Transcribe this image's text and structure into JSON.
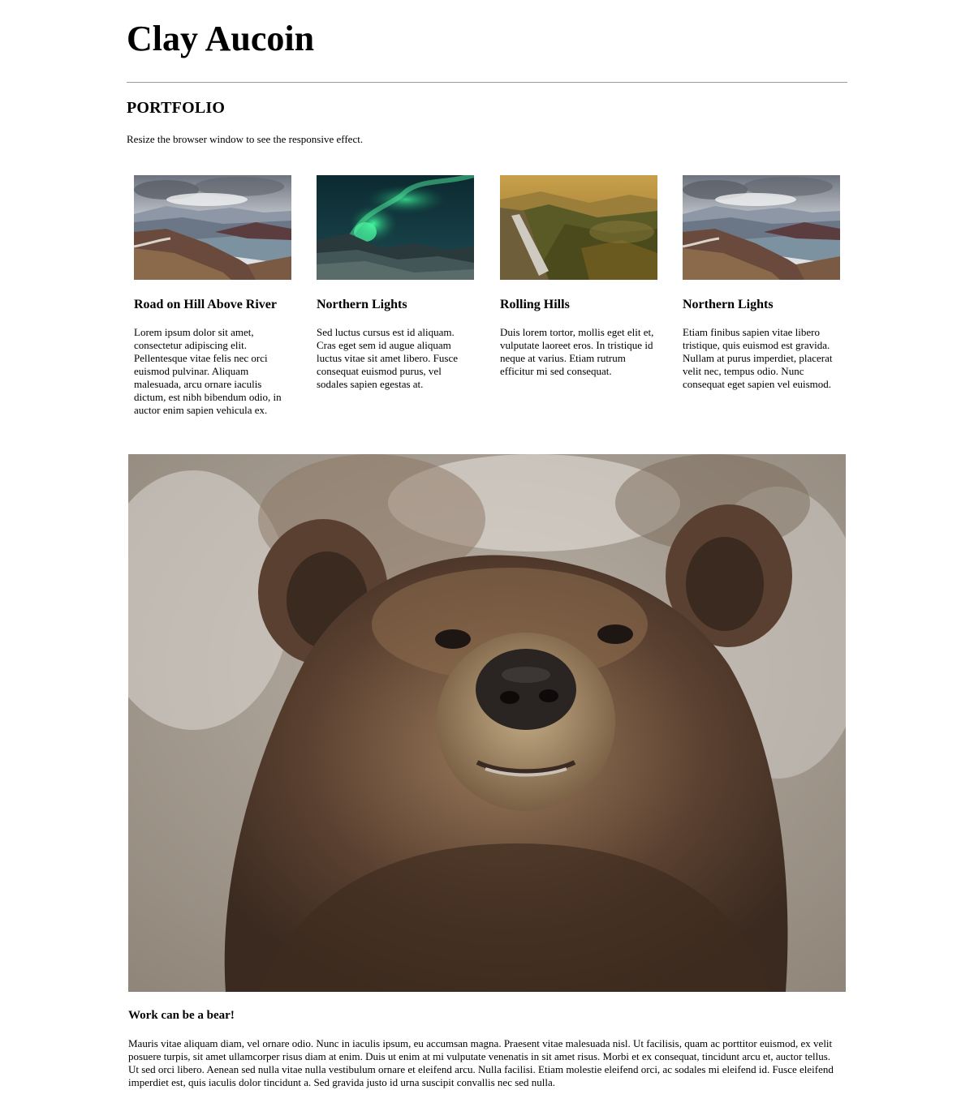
{
  "site": {
    "title": "Clay Aucoin"
  },
  "portfolio": {
    "heading": "PORTFOLIO",
    "intro": "Resize the browser window to see the responsive effect.",
    "items": [
      {
        "title": "Road on Hill Above River",
        "text": "Lorem ipsum dolor sit amet, consectetur adipiscing elit. Pellentesque vitae felis nec orci euismod pulvinar. Aliquam malesuada, arcu ornare iaculis dictum, est nibh bibendum odio, in auctor enim sapien vehicula ex."
      },
      {
        "title": "Northern Lights",
        "text": "Sed luctus cursus est id aliquam. Cras eget sem id augue aliquam luctus vitae sit amet libero. Fusce consequat euismod purus, vel sodales sapien egestas at."
      },
      {
        "title": "Rolling Hills",
        "text": "Duis lorem tortor, mollis eget elit et, vulputate laoreet eros. In tristique id neque at varius. Etiam rutrum efficitur mi sed consequat."
      },
      {
        "title": "Northern Lights",
        "text": "Etiam finibus sapien vitae libero tristique, quis euismod est gravida. Nullam at purus imperdiet, placerat velit nec, tempus odio. Nunc consequat eget sapien vel euismod."
      }
    ]
  },
  "feature": {
    "title": "Work can be a bear!",
    "text": "Mauris vitae aliquam diam, vel ornare odio. Nunc in iaculis ipsum, eu accumsan magna. Praesent vitae malesuada nisl. Ut facilisis, quam ac porttitor euismod, ex velit posuere turpis, sit amet ullamcorper risus diam at enim. Duis ut enim at mi vulputate venenatis in sit amet risus. Morbi et ex consequat, tincidunt arcu et, auctor tellus. Ut sed orci libero. Aenean sed nulla vitae nulla vestibulum ornare et eleifend arcu. Nulla facilisi. Etiam molestie eleifend orci, ac sodales mi eleifend id. Fusce eleifend imperdiet est, quis iaculis dolor tincidunt a. Sed gravida justo id urna suscipit convallis nec sed nulla."
  }
}
